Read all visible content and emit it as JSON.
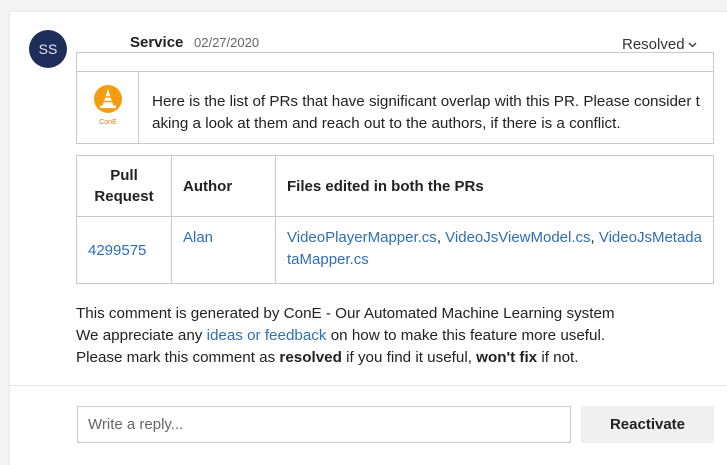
{
  "comment": {
    "avatar_initials": "SS",
    "author": "Service",
    "date": "02/27/2020",
    "status": "Resolved",
    "bot_icon": {
      "name": "cone-bot-icon",
      "label": "ConE",
      "color": "#f39c12"
    },
    "intro_text": "Here is the list of PRs that have significant overlap with this PR. Please consider taking a look at them and reach out to the authors, if there is a conflict."
  },
  "pr_table": {
    "headers": {
      "pull_request_line1": "Pull",
      "pull_request_line2": "Request",
      "author": "Author",
      "files": "Files edited in both the PRs"
    },
    "rows": [
      {
        "pr": "4299575",
        "author": "Alan",
        "files": [
          "VideoPlayerMapper.cs",
          "VideoJsViewModel.cs",
          "VideoJsMetadataMapper.cs"
        ],
        "file_separator": ", "
      }
    ]
  },
  "footer": {
    "line1": "This comment is generated by ConE - Our Automated Machine Learning system",
    "line2_prefix": "We appreciate any ",
    "line2_link": "ideas or feedback",
    "line2_suffix": " on how to make this feature more useful.",
    "line3_prefix": "Please mark this comment as ",
    "line3_bold1": "resolved",
    "line3_mid": " if you find it useful, ",
    "line3_bold2": "won't fix",
    "line3_suffix": " if not."
  },
  "reply": {
    "placeholder": "Write a reply...",
    "value": "",
    "reactivate_label": "Reactivate"
  },
  "colors": {
    "avatar_bg": "#1f2d5a",
    "link": "#2f6fb5",
    "border": "#c9c9c9"
  }
}
